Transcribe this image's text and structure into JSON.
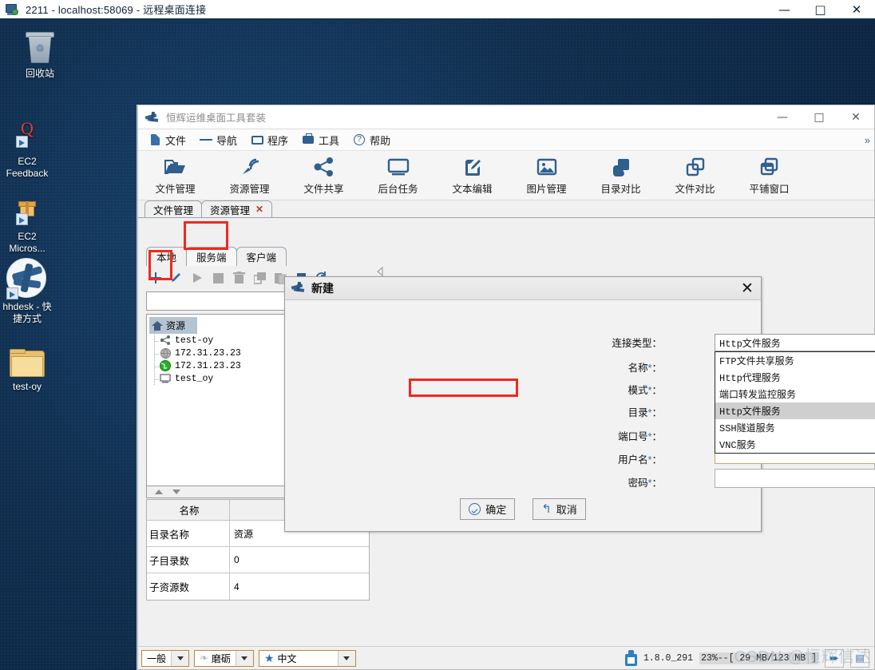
{
  "os_window": {
    "title": "2211 - localhost:58069 - 远程桌面连接",
    "icon": "remote-desktop-icon",
    "minimize": "—",
    "maximize": "□",
    "close": "✕"
  },
  "desktop": {
    "icons": [
      {
        "label": "回收站",
        "icon": "recycle-bin-icon"
      },
      {
        "label": "EC2\nFeedback",
        "label_line1": "EC2",
        "label_line2": "Feedback",
        "icon": "ec2-feedback-icon"
      },
      {
        "label_line1": "EC2",
        "label_line2": "Micros...",
        "icon": "ec2-microsoft-icon"
      },
      {
        "label_line1": "hhdesk - 快",
        "label_line2": "捷方式",
        "icon": "hhdesk-icon"
      },
      {
        "label_line1": "test-oy",
        "label_line2": "",
        "icon": "folder-icon"
      }
    ]
  },
  "app": {
    "title": "恒辉运维桌面工具套装",
    "window_controls": {
      "minimize": "—",
      "maximize": "□",
      "close": "✕"
    },
    "menu": [
      {
        "label": "文件",
        "icon": "file-icon"
      },
      {
        "label": "导航",
        "icon": "nav-icon"
      },
      {
        "label": "程序",
        "icon": "program-icon"
      },
      {
        "label": "工具",
        "icon": "tools-icon"
      },
      {
        "label": "帮助",
        "icon": "help-icon"
      }
    ],
    "toolbar": [
      {
        "label": "文件管理",
        "icon": "folder-open-icon"
      },
      {
        "label": "资源管理",
        "icon": "satellite-icon"
      },
      {
        "label": "文件共享",
        "icon": "share-icon"
      },
      {
        "label": "后台任务",
        "icon": "monitor-icon"
      },
      {
        "label": "文本编辑",
        "icon": "edit-square-icon"
      },
      {
        "label": "图片管理",
        "icon": "image-icon"
      },
      {
        "label": "目录对比",
        "icon": "copy-filled-icon"
      },
      {
        "label": "文件对比",
        "icon": "copy-outline-icon"
      },
      {
        "label": "平铺窗口",
        "icon": "tile-windows-icon"
      }
    ],
    "tabs": [
      {
        "label": "文件管理",
        "closable": false,
        "active": false
      },
      {
        "label": "资源管理",
        "closable": true,
        "close": "✕",
        "active": true
      }
    ],
    "subtabs": [
      {
        "label": "本地",
        "active": false
      },
      {
        "label": "服务端",
        "active": true
      },
      {
        "label": "客户端",
        "active": false
      }
    ],
    "server_toolbar": [
      {
        "icon": "plus-icon",
        "name": "add"
      },
      {
        "icon": "pencil-icon",
        "name": "edit"
      },
      {
        "icon": "play-icon",
        "name": "start"
      },
      {
        "icon": "stop-icon",
        "name": "stop"
      },
      {
        "icon": "trash-icon",
        "name": "delete"
      },
      {
        "icon": "duplicate-icon",
        "name": "duplicate"
      },
      {
        "icon": "copy-icon",
        "name": "copy"
      },
      {
        "icon": "paste-icon",
        "name": "paste"
      },
      {
        "icon": "refresh-icon",
        "name": "refresh"
      }
    ],
    "filter": {
      "value": "",
      "placeholder": ""
    },
    "tree": {
      "root": {
        "label": "资源",
        "icon": "home-icon"
      },
      "items": [
        {
          "label": "test-oy",
          "icon": "share-node-icon"
        },
        {
          "label": "172.31.23.23",
          "icon": "globe-gray-icon"
        },
        {
          "label": "172.31.23.23",
          "icon": "globe-green-icon"
        },
        {
          "label": "test_oy",
          "icon": "monitor-small-icon"
        }
      ]
    },
    "property_table": {
      "headers": [
        "名称",
        ""
      ],
      "rows": [
        {
          "name": "目录名称",
          "value": "资源"
        },
        {
          "name": "子目录数",
          "value": "0"
        },
        {
          "name": "子资源数",
          "value": "4"
        }
      ]
    }
  },
  "dialog": {
    "title": "新建",
    "icon": "hhdesk-logo-icon",
    "close": "✕",
    "fields": [
      {
        "label": "连接类型：",
        "required": false,
        "type": "combo",
        "value": "Http文件服务"
      },
      {
        "label": "名称",
        "required": true,
        "suffix": "：",
        "type": "text",
        "value": ""
      },
      {
        "label": "模式",
        "required": true,
        "suffix": "：",
        "type": "text",
        "value": ""
      },
      {
        "label": "目录",
        "required": true,
        "suffix": "：",
        "type": "text",
        "value": ""
      },
      {
        "label": "端口号",
        "required": true,
        "suffix": "：",
        "type": "text",
        "value": ""
      },
      {
        "label": "用户名",
        "required": true,
        "suffix": "：",
        "type": "text",
        "value": ""
      },
      {
        "label": "密码",
        "required": true,
        "suffix": "：",
        "type": "password",
        "value": ""
      }
    ],
    "dropdown_open": true,
    "dropdown_options": [
      {
        "label": "FTP文件共享服务",
        "selected": false
      },
      {
        "label": "Http代理服务",
        "selected": false
      },
      {
        "label": "端口转发监控服务",
        "selected": false
      },
      {
        "label": "Http文件服务",
        "selected": true
      },
      {
        "label": "SSH隧道服务",
        "selected": false
      },
      {
        "label": "VNC服务",
        "selected": false
      }
    ],
    "buttons": [
      {
        "label": "确定",
        "icon": "check-circle-icon"
      },
      {
        "label": "取消",
        "icon": "back-arrow-icon"
      }
    ],
    "password_toggle_icon": "eye-icon"
  },
  "statusbar": {
    "combos": [
      {
        "value": "一般",
        "icon": ""
      },
      {
        "value": "磨砺",
        "icon": "leaf-icon"
      },
      {
        "value": "中文",
        "icon": "star-icon"
      }
    ],
    "version": "1.8.0_291",
    "progress_text": "23%--[ 29 MB/123 MB ]",
    "progress_percent": 23,
    "bottle_icon": "bottle-icon",
    "right_icons": [
      "blue-arrow-icon",
      "blue-panel-icon"
    ]
  },
  "watermark": "CSDN @恒辉信达",
  "colors": {
    "accent": "#2f5f8f",
    "annotation": "#ee2a1e",
    "desktop": "#0d2a4a",
    "panel": "#f0f0f0",
    "selection": "#cfcfcf"
  }
}
